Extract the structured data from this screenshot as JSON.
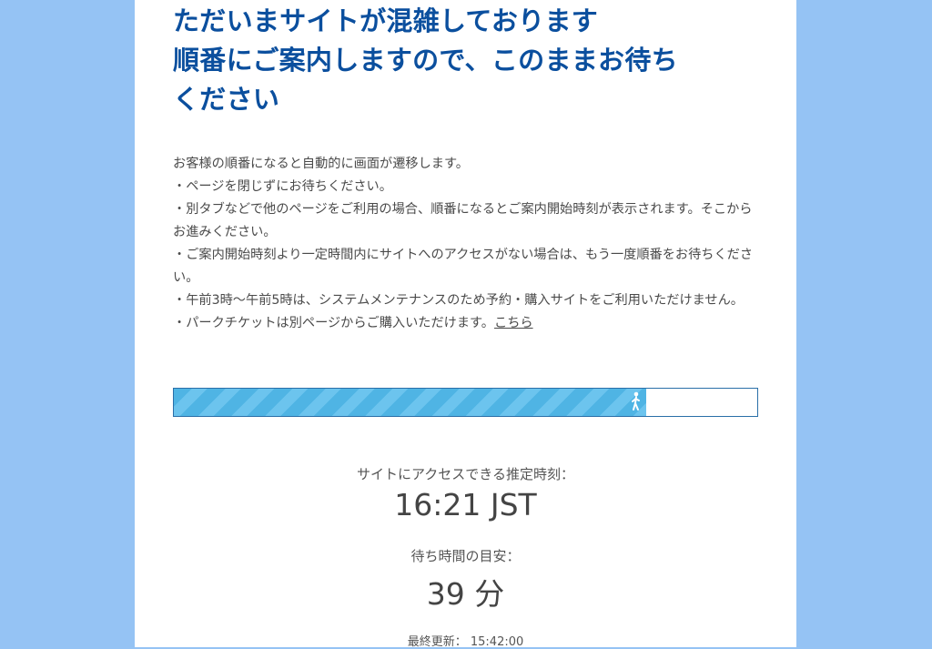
{
  "headline": {
    "line1": "ただいまサイトが混雑しております",
    "line2": "順番にご案内しますので、このままお待ち",
    "line3": "ください"
  },
  "intro": {
    "p1": "お客様の順番になると自動的に画面が遷移します。",
    "p2": "・ページを閉じずにお待ちください。",
    "p3": "・別タブなどで他のページをご利用の場合、順番になるとご案内開始時刻が表示されます。そこからお進みください。",
    "p4": "・ご案内開始時刻より一定時間内にサイトへのアクセスがない場合は、もう一度順番をお待ちください。",
    "p5": "・午前3時～午前5時は、システムメンテナンスのため予約・購入サイトをご利用いただけません。",
    "p6_text": "・パークチケットは別ページからご購入いただけます。",
    "p6_link": "こちら"
  },
  "progress": {
    "percent": 81,
    "icon": "walking-person-icon"
  },
  "estimate": {
    "label": "サイトにアクセスできる推定時刻：",
    "time": "16:21 JST"
  },
  "wait": {
    "label": "待ち時間の目安：",
    "minutes": "39 分"
  },
  "updated": {
    "label": "最終更新：",
    "time": "15:42:00"
  },
  "colors": {
    "background": "#95c3f4",
    "headline": "#0b4f9e",
    "progress_fill": "#4fb4e4"
  }
}
